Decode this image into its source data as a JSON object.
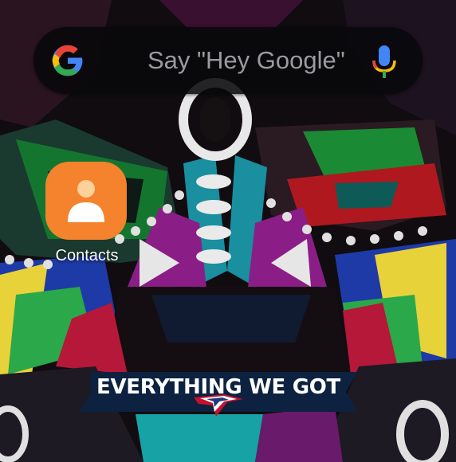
{
  "search": {
    "hint": "Say \"Hey Google\"",
    "logo_icon": "google-g-icon",
    "mic_icon": "mic-icon"
  },
  "apps": [
    {
      "label": "Contacts",
      "icon": "contacts-icon",
      "color": "#f5822d"
    }
  ],
  "wallpaper": {
    "banner_text": "EVERYTHING WE GOT",
    "banner_logo": "patriots-logo"
  },
  "colors": {
    "google_blue": "#4285f4",
    "google_red": "#ea4335",
    "google_yellow": "#fbbc05",
    "google_green": "#34a853"
  }
}
